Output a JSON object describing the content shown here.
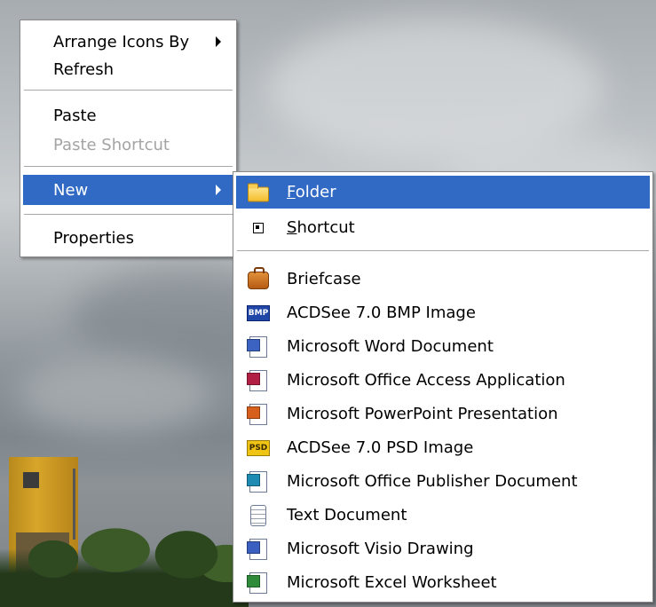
{
  "main_menu": {
    "items": [
      {
        "label": "Arrange Icons By",
        "submenu": true
      },
      {
        "label": "Refresh"
      },
      {
        "label": "Paste"
      },
      {
        "label": "Paste Shortcut",
        "disabled": true
      },
      {
        "label": "New",
        "submenu": true,
        "highlighted": true
      },
      {
        "label": "Properties"
      }
    ]
  },
  "new_submenu": {
    "folder": {
      "pre": "",
      "accel": "F",
      "post": "older",
      "icon": "folder-icon"
    },
    "shortcut": {
      "pre": "",
      "accel": "S",
      "post": "hortcut",
      "icon": "shortcut-icon"
    },
    "items": [
      {
        "label": "Briefcase",
        "icon": "briefcase-icon"
      },
      {
        "label": "ACDSee 7.0 BMP Image",
        "icon": "bmp-icon",
        "badge": "BMP"
      },
      {
        "label": "Microsoft Word Document",
        "icon": "word-document-icon"
      },
      {
        "label": "Microsoft Office Access Application",
        "icon": "access-icon"
      },
      {
        "label": "Microsoft PowerPoint Presentation",
        "icon": "powerpoint-icon"
      },
      {
        "label": "ACDSee 7.0 PSD Image",
        "icon": "psd-icon",
        "badge": "PSD"
      },
      {
        "label": "Microsoft Office Publisher Document",
        "icon": "publisher-icon"
      },
      {
        "label": "Text Document",
        "icon": "text-document-icon"
      },
      {
        "label": "Microsoft Visio Drawing",
        "icon": "visio-icon"
      },
      {
        "label": "Microsoft Excel Worksheet",
        "icon": "excel-icon"
      }
    ]
  },
  "colors": {
    "highlight": "#316ac5",
    "menu_bg": "#ffffff",
    "disabled_text": "#a4a4a4"
  }
}
